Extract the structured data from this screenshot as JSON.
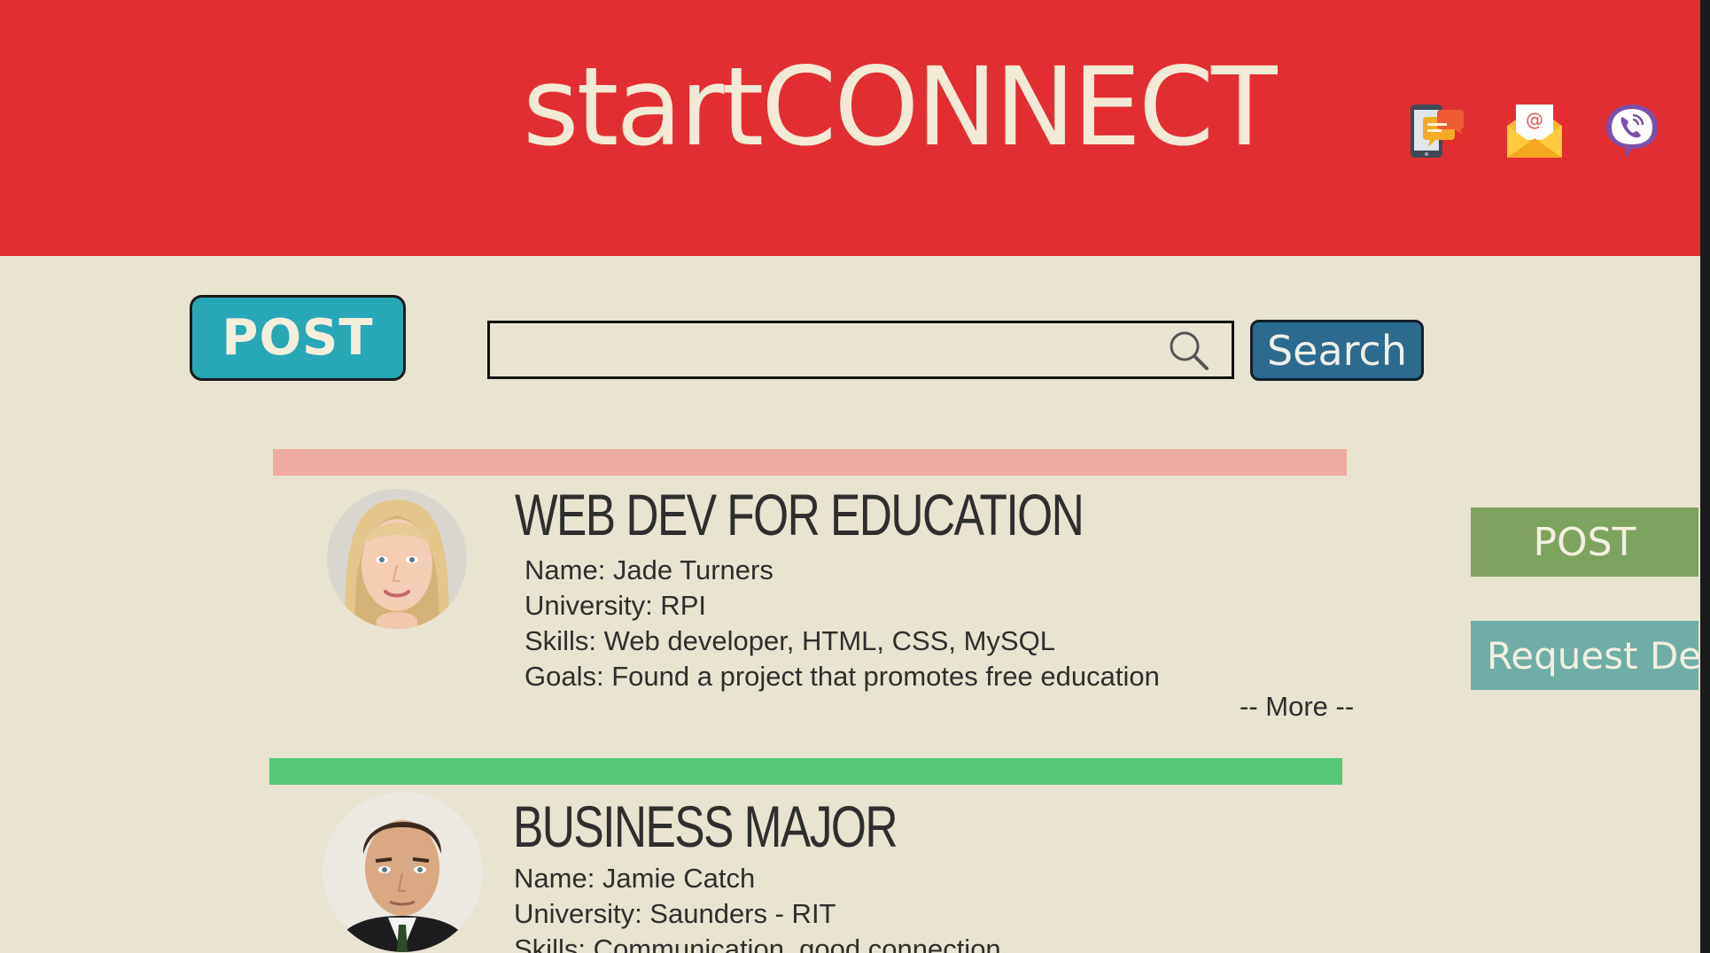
{
  "header": {
    "brand_start": "start",
    "brand_connect": "CONNECT",
    "icons": [
      "chat-icon",
      "email-icon",
      "phone-call-icon"
    ]
  },
  "toolbar": {
    "post_label": "POST",
    "search_placeholder": "",
    "search_value": "",
    "search_label": "Search"
  },
  "side": {
    "post_label": "POST",
    "request_label": "Request Del"
  },
  "posts": [
    {
      "title": "WEB DEV FOR EDUCATION",
      "name": "Name: Jade Turners",
      "university": "University: RPI",
      "skills": "Skills: Web developer, HTML, CSS, MySQL",
      "goals": "Goals: Found a project that promotes free education",
      "more": "-- More --",
      "bar_color": "#f0aba0"
    },
    {
      "title": "BUSINESS MAJOR",
      "name": "Name: Jamie Catch",
      "university": "University: Saunders - RIT",
      "skills": "Skills: Communication, good connection",
      "bar_color": "#56c778"
    }
  ],
  "colors": {
    "header": "#e32e31",
    "background": "#e8e4d1",
    "post_button": "#28a7b6",
    "search_button": "#2a6b8e",
    "side_post": "#7ea35e",
    "side_request": "#6fada6"
  }
}
